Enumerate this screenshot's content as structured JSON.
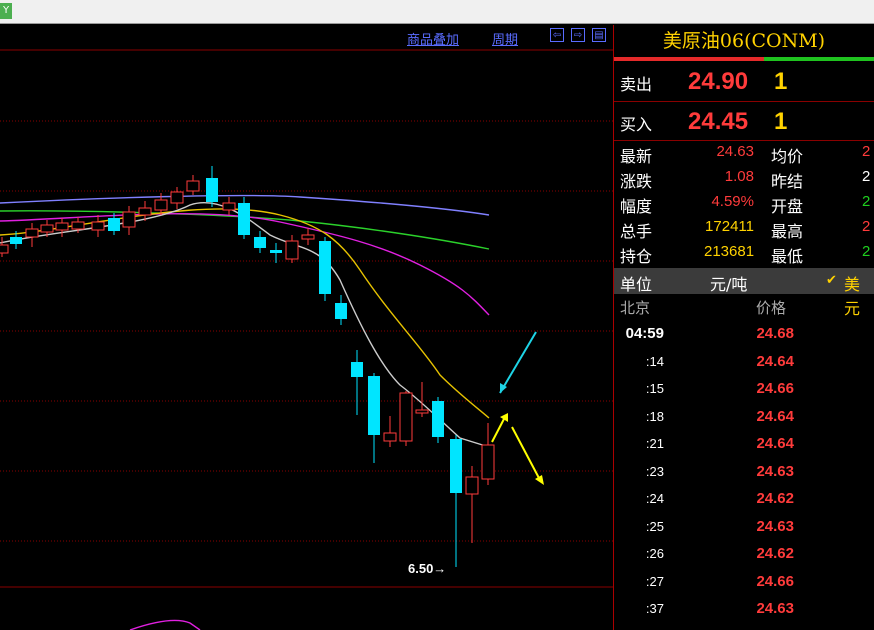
{
  "window": {
    "app_icon": "Y"
  },
  "toolbar": {
    "overlay_label": "商品叠加",
    "period_label": "周期",
    "nav_icons": [
      "arrow-left-icon",
      "arrow-right-icon",
      "panel-icon"
    ]
  },
  "chart": {
    "low_label": "6.50→",
    "colors": {
      "up": "#ff3b3b",
      "down": "#00e5ff",
      "ma5": "#cccccc",
      "ma10": "#e6c200",
      "ma20": "#e020e0",
      "ma30": "#2bd12b",
      "ma60": "#8080ff",
      "arrow_cyan": "#1ed4e6",
      "arrow_yellow": "#ffff00",
      "grid": "#8a0000"
    }
  },
  "quote": {
    "title": "美原油06(CONM)",
    "ask": {
      "label": "卖出",
      "price": "24.90",
      "volume": "1"
    },
    "bid": {
      "label": "买入",
      "price": "24.45",
      "volume": "1"
    },
    "rows": [
      {
        "label": "最新",
        "value": "24.63",
        "color": "#ff3b3b",
        "label2": "均价",
        "value2": "2",
        "color2": "#ff3b3b"
      },
      {
        "label": "涨跌",
        "value": "1.08",
        "color": "#ff3b3b",
        "label2": "昨结",
        "value2": "2",
        "color2": "#ffffff"
      },
      {
        "label": "幅度",
        "value": "4.59%",
        "color": "#ff3b3b",
        "label2": "开盘",
        "value2": "2",
        "color2": "#1fd01f"
      },
      {
        "label": "总手",
        "value": "172411",
        "color": "#ffd200",
        "label2": "最高",
        "value2": "2",
        "color2": "#ff3b3b"
      },
      {
        "label": "持仓",
        "value": "213681",
        "color": "#ffd200",
        "label2": "最低",
        "value2": "2",
        "color2": "#1fd01f"
      }
    ],
    "unit": {
      "label": "单位",
      "value": "元/吨",
      "check": "✔",
      "currency": "美元"
    },
    "ticks_header": {
      "city": "北京",
      "price": "价格"
    },
    "ticks": [
      {
        "time": "04:59",
        "price": "24.68"
      },
      {
        "time": ":14",
        "price": "24.64"
      },
      {
        "time": ":15",
        "price": "24.66"
      },
      {
        "time": ":18",
        "price": "24.64"
      },
      {
        "time": ":21",
        "price": "24.64"
      },
      {
        "time": ":23",
        "price": "24.63"
      },
      {
        "time": ":24",
        "price": "24.62"
      },
      {
        "time": ":25",
        "price": "24.63"
      },
      {
        "time": ":26",
        "price": "24.62"
      },
      {
        "time": ":27",
        "price": "24.66"
      },
      {
        "time": ":37",
        "price": "24.63"
      }
    ]
  }
}
